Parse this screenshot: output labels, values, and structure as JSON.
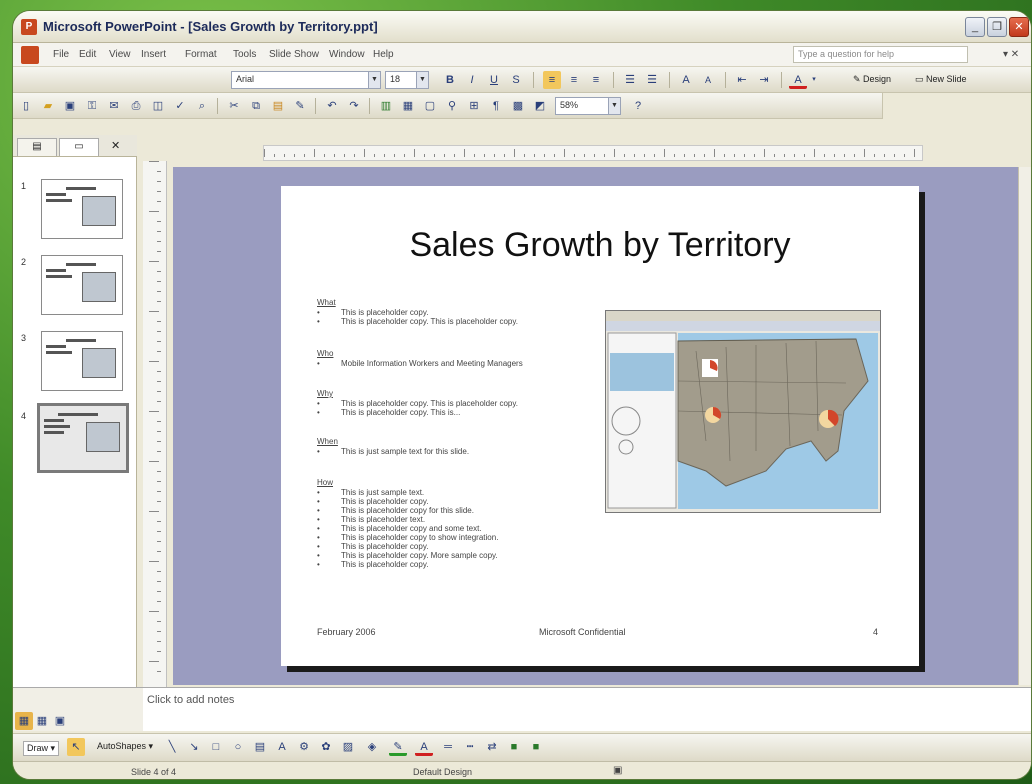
{
  "window": {
    "title": "Microsoft PowerPoint - [Sales Growth by Territory.ppt]",
    "controls": [
      "minimize",
      "restore",
      "close"
    ]
  },
  "menu": {
    "items": [
      "File",
      "Edit",
      "View",
      "Insert",
      "Format",
      "Tools",
      "Slide Show",
      "Window",
      "Help"
    ],
    "help_placeholder": "Type a question for help"
  },
  "format_toolbar": {
    "font": "Arial",
    "size": "18",
    "design_label": "Design",
    "new_slide_label": "New Slide"
  },
  "standard_toolbar": {
    "zoom": "58%"
  },
  "panes": {
    "tabs": [
      "Outline",
      "Slides"
    ],
    "slide_numbers": [
      "1",
      "2",
      "3",
      "4"
    ],
    "selected": "4"
  },
  "slide": {
    "title": "Sales Growth by Territory",
    "sections": [
      {
        "heading": "What",
        "bullets": [
          "This is placeholder copy.",
          "This is placeholder copy. This is placeholder copy."
        ]
      },
      {
        "heading": "Who",
        "bullets": [
          "Mobile Information Workers and Meeting Managers"
        ]
      },
      {
        "heading": "Why",
        "bullets": [
          "This is placeholder copy. This is placeholder copy.",
          "This is placeholder copy. This is..."
        ]
      },
      {
        "heading": "When",
        "bullets": [
          "This is just sample text for this slide."
        ]
      },
      {
        "heading": "How",
        "bullets": [
          "This is just sample text.",
          "This is placeholder copy.",
          "This is placeholder copy for this slide.",
          "This is placeholder text.",
          "This is placeholder copy and some text.",
          "This is placeholder copy to show integration.",
          "This is placeholder copy.",
          "This is placeholder copy. More sample copy.",
          "This is placeholder copy."
        ]
      }
    ],
    "footer": {
      "date": "February 2006",
      "center": "Microsoft Confidential",
      "page": "4"
    }
  },
  "notes": {
    "placeholder": "Click to add notes"
  },
  "draw_toolbar": {
    "draw_label": "Draw",
    "autoshapes_label": "AutoShapes"
  },
  "status": {
    "slide": "Slide 4 of 4",
    "design": "Default Design"
  },
  "colors": {
    "stage": "#9a9cc0",
    "title_bar": "#1c2a5a",
    "close": "#c23a1c"
  }
}
